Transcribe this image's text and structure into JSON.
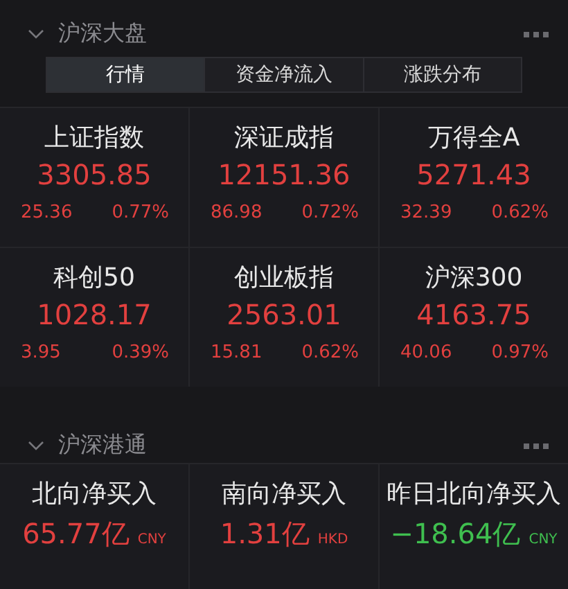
{
  "market_section": {
    "title": "沪深大盘",
    "expanded": true,
    "tabs": [
      {
        "label": "行情",
        "selected": true
      },
      {
        "label": "资金净流入",
        "selected": false
      },
      {
        "label": "涨跌分布",
        "selected": false
      }
    ],
    "indices": [
      {
        "name": "上证指数",
        "value": "3305.85",
        "change": "25.36",
        "percent": "0.77%",
        "color": "#e2403f"
      },
      {
        "name": "深证成指",
        "value": "12151.36",
        "change": "86.98",
        "percent": "0.72%",
        "color": "#e2403f"
      },
      {
        "name": "万得全A",
        "value": "5271.43",
        "change": "32.39",
        "percent": "0.62%",
        "color": "#e2403f"
      },
      {
        "name": "科创50",
        "value": "1028.17",
        "change": "3.95",
        "percent": "0.39%",
        "color": "#e2403f"
      },
      {
        "name": "创业板指",
        "value": "2563.01",
        "change": "15.81",
        "percent": "0.62%",
        "color": "#e2403f"
      },
      {
        "name": "沪深300",
        "value": "4163.75",
        "change": "40.06",
        "percent": "0.97%",
        "color": "#e2403f"
      }
    ]
  },
  "connect_section": {
    "title": "沪深港通",
    "expanded": true,
    "flows": [
      {
        "name": "北向净买入",
        "value": "65.77亿",
        "currency": "CNY",
        "color": "#e2403f"
      },
      {
        "name": "南向净买入",
        "value": "1.31亿",
        "currency": "HKD",
        "color": "#e2403f"
      },
      {
        "name": "昨日北向净买入",
        "value": "−18.64亿",
        "currency": "CNY",
        "color": "#3fbf4f"
      }
    ]
  }
}
